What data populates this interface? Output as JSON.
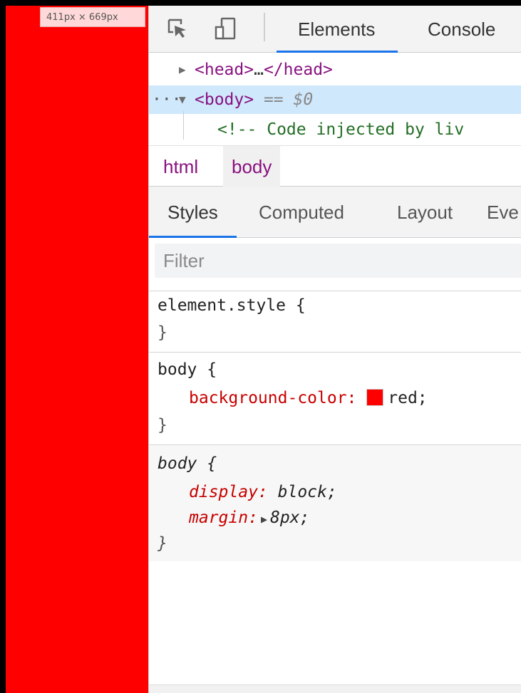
{
  "viewport": {
    "background_color": "#ff0000",
    "dimension_badge": "411px × 669px"
  },
  "devtools": {
    "toolbar": {
      "tabs": [
        "Elements",
        "Console"
      ],
      "active_tab": "Elements",
      "icons": [
        "inspect-element-icon",
        "device-toolbar-icon"
      ]
    },
    "dom_tree": {
      "rows": [
        {
          "tag_open": "<head>",
          "ellipsis": "…",
          "tag_close": "</head>"
        },
        {
          "prefix": "···",
          "tag_open": "<body>",
          "selected_marker": "== $0"
        },
        {
          "comment": "<!-- Code injected by liv"
        }
      ]
    },
    "breadcrumb": [
      "html",
      "body"
    ],
    "subtabs": [
      "Styles",
      "Computed",
      "Layout",
      "Eve"
    ],
    "active_subtab": "Styles",
    "filter": {
      "placeholder": "Filter",
      "value": ""
    },
    "rules": [
      {
        "selector": "element.style {",
        "close": "}"
      },
      {
        "selector": "body {",
        "property": "background-color:",
        "value": "red;",
        "swatch_color": "#ff0000",
        "close": "}"
      },
      {
        "selector": "body {",
        "props": [
          {
            "property": "display:",
            "value": "block;"
          },
          {
            "property": "margin:",
            "value": "8px;"
          }
        ],
        "close": "}"
      }
    ]
  }
}
